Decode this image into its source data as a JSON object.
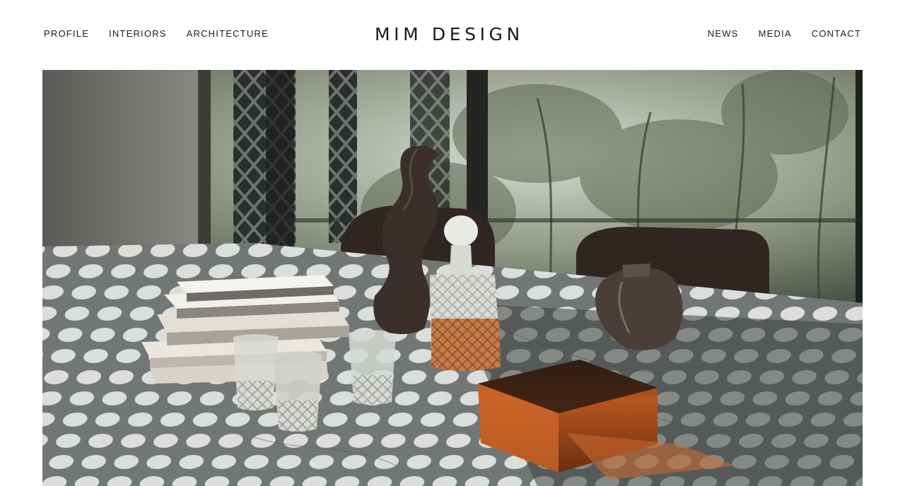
{
  "header": {
    "logo": "MIM DESIGN",
    "nav_left": [
      {
        "label": "PROFILE"
      },
      {
        "label": "INTERIORS"
      },
      {
        "label": "ARCHITECTURE"
      }
    ],
    "nav_right": [
      {
        "label": "NEWS"
      },
      {
        "label": "MEDIA"
      },
      {
        "label": "CONTACT"
      }
    ]
  },
  "colors": {
    "background": "#ffffff",
    "text": "#1a1a1a",
    "marble": "#8e9391",
    "amber": "#c8642a"
  }
}
